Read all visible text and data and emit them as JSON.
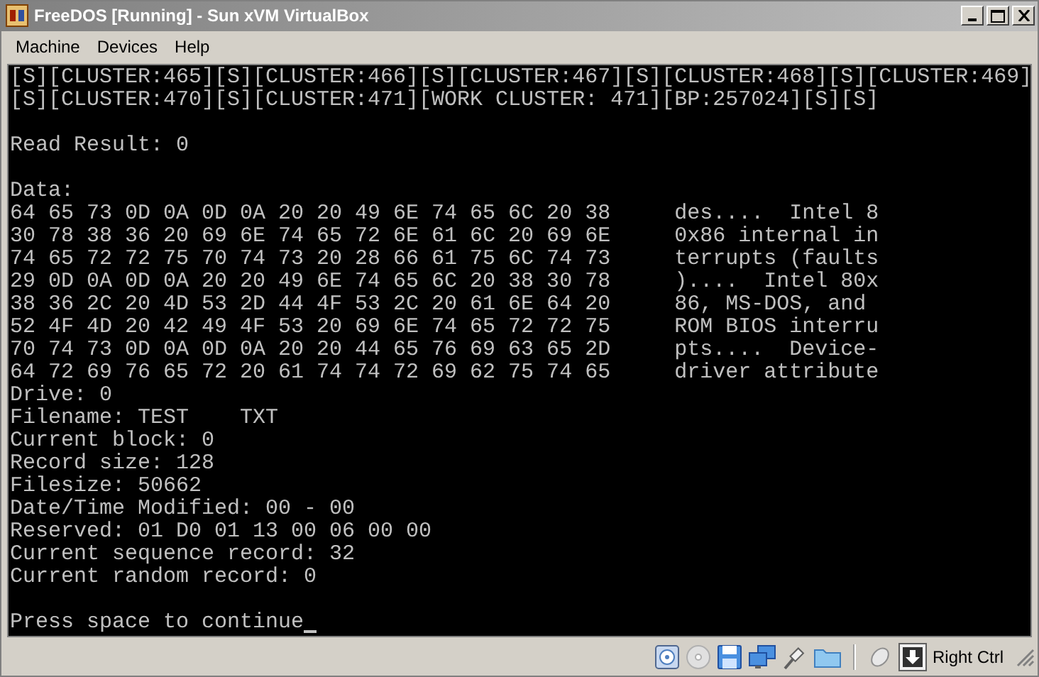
{
  "window": {
    "title": "FreeDOS [Running] - Sun xVM VirtualBox"
  },
  "menu": [
    "Machine",
    "Devices",
    "Help"
  ],
  "console": {
    "lines": [
      {
        "kind": "text",
        "text": "[S][CLUSTER:465][S][CLUSTER:466][S][CLUSTER:467][S][CLUSTER:468][S][CLUSTER:469]"
      },
      {
        "kind": "text",
        "text": "[S][CLUSTER:470][S][CLUSTER:471][WORK CLUSTER: 471][BP:257024][S][S]"
      },
      {
        "kind": "blank"
      },
      {
        "kind": "text",
        "text": "Read Result: 0"
      },
      {
        "kind": "blank"
      },
      {
        "kind": "text",
        "text": "Data:"
      },
      {
        "kind": "hex",
        "hex": "64 65 73 0D 0A 0D 0A 20 20 49 6E 74 65 6C 20 38",
        "ascii": "des....  Intel 8"
      },
      {
        "kind": "hex",
        "hex": "30 78 38 36 20 69 6E 74 65 72 6E 61 6C 20 69 6E",
        "ascii": "0x86 internal in"
      },
      {
        "kind": "hex",
        "hex": "74 65 72 72 75 70 74 73 20 28 66 61 75 6C 74 73",
        "ascii": "terrupts (faults"
      },
      {
        "kind": "hex",
        "hex": "29 0D 0A 0D 0A 20 20 49 6E 74 65 6C 20 38 30 78",
        "ascii": ")....  Intel 80x"
      },
      {
        "kind": "hex",
        "hex": "38 36 2C 20 4D 53 2D 44 4F 53 2C 20 61 6E 64 20",
        "ascii": "86, MS-DOS, and"
      },
      {
        "kind": "hex",
        "hex": "52 4F 4D 20 42 49 4F 53 20 69 6E 74 65 72 72 75",
        "ascii": "ROM BIOS interru"
      },
      {
        "kind": "hex",
        "hex": "70 74 73 0D 0A 0D 0A 20 20 44 65 76 69 63 65 2D",
        "ascii": "pts....  Device-"
      },
      {
        "kind": "hex",
        "hex": "64 72 69 76 65 72 20 61 74 74 72 69 62 75 74 65",
        "ascii": "driver attribute"
      },
      {
        "kind": "text",
        "text": "Drive: 0"
      },
      {
        "kind": "text",
        "text": "Filename: TEST    TXT"
      },
      {
        "kind": "text",
        "text": "Current block: 0"
      },
      {
        "kind": "text",
        "text": "Record size: 128"
      },
      {
        "kind": "text",
        "text": "Filesize: 50662"
      },
      {
        "kind": "text",
        "text": "Date/Time Modified: 00 - 00"
      },
      {
        "kind": "text",
        "text": "Reserved: 01 D0 01 13 00 06 00 00"
      },
      {
        "kind": "text",
        "text": "Current sequence record: 32"
      },
      {
        "kind": "text",
        "text": "Current random record: 0"
      },
      {
        "kind": "blank"
      },
      {
        "kind": "text",
        "text": "Press space to continue",
        "cursor": true
      }
    ]
  },
  "status_bar": {
    "host_key": "Right Ctrl"
  }
}
